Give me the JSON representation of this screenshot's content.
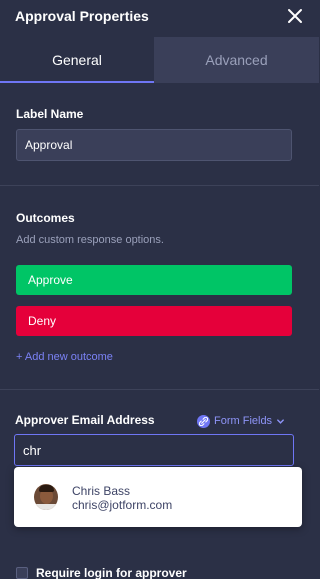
{
  "header": {
    "title": "Approval Properties",
    "close_icon": "close-icon"
  },
  "tabs": [
    {
      "label": "General",
      "active": true
    },
    {
      "label": "Advanced",
      "active": false
    }
  ],
  "label_name": {
    "label": "Label Name",
    "value": "Approval"
  },
  "outcomes": {
    "title": "Outcomes",
    "description": "Add custom response options.",
    "items": [
      {
        "label": "Approve",
        "color": "#00c566"
      },
      {
        "label": "Deny",
        "color": "#e5003a"
      }
    ],
    "add_label": "+ Add new outcome"
  },
  "approver": {
    "label": "Approver Email Address",
    "form_fields_label": "Form Fields",
    "input_value": "chr",
    "suggestions": [
      {
        "name": "Chris Bass",
        "email": "chris@jotform.com"
      }
    ]
  },
  "require_login": {
    "label": "Require login for approver",
    "checked": false
  },
  "colors": {
    "background": "#2b3046",
    "accent": "#6f76f5",
    "approve": "#00c566",
    "deny": "#e5003a"
  }
}
